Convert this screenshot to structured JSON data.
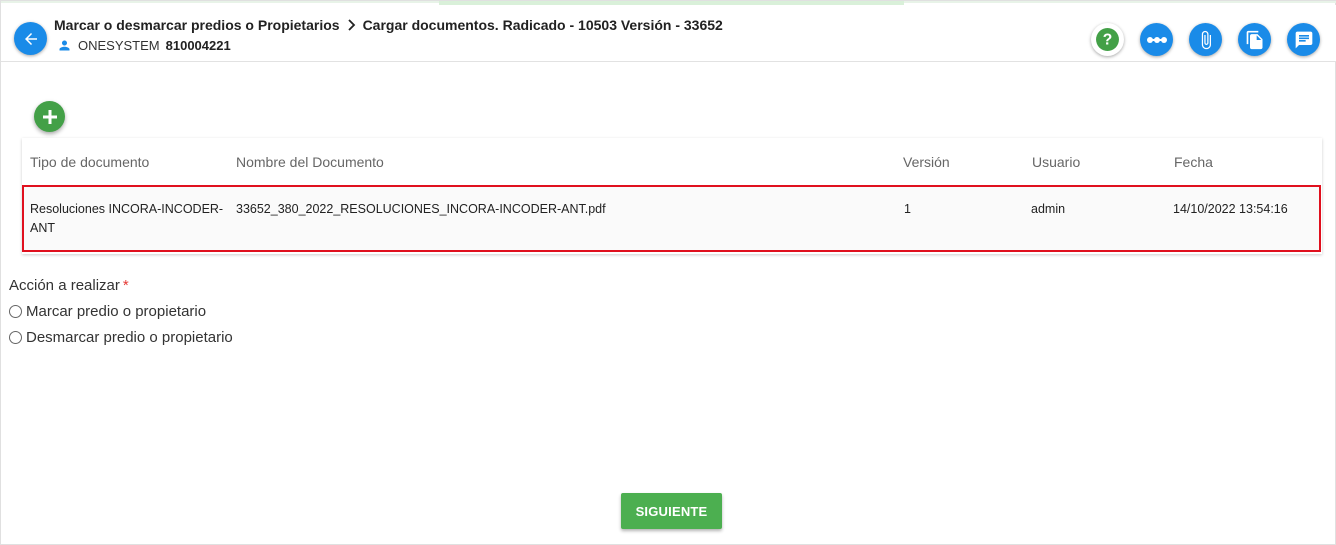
{
  "header": {
    "breadcrumb": [
      "Marcar o desmarcar predios o Propietarios",
      "Cargar documentos. Radicado - 10503 Versión - 33652"
    ],
    "user_name": "ONESYSTEM",
    "user_code": "810004221"
  },
  "actions": [
    {
      "name": "help-button",
      "icon": "question-icon",
      "color": "#43a047"
    },
    {
      "name": "flow-button",
      "icon": "dots-icon",
      "color": "#1a8be8"
    },
    {
      "name": "attach-button",
      "icon": "paperclip-icon",
      "color": "#1a8be8"
    },
    {
      "name": "documents-button",
      "icon": "copy-icon",
      "color": "#1a8be8"
    },
    {
      "name": "comments-button",
      "icon": "comment-icon",
      "color": "#1a8be8"
    }
  ],
  "table": {
    "columns": [
      "Tipo de documento",
      "Nombre del Documento",
      "Versión",
      "Usuario",
      "Fecha"
    ],
    "rows": [
      {
        "tipo": "Resoluciones INCORA-INCODER-ANT",
        "nombre": "33652_380_2022_RESOLUCIONES_INCORA-INCODER-ANT.pdf",
        "version": "1",
        "usuario": "admin",
        "fecha": "14/10/2022 13:54:16"
      }
    ]
  },
  "form": {
    "label": "Acción a realizar",
    "required_mark": "*",
    "options": [
      "Marcar predio o propietario",
      "Desmarcar predio o propietario"
    ]
  },
  "next_label": "SIGUIENTE",
  "colors": {
    "primary": "#1a8be8",
    "success": "#4caf50",
    "highlight": "#e0101e"
  }
}
